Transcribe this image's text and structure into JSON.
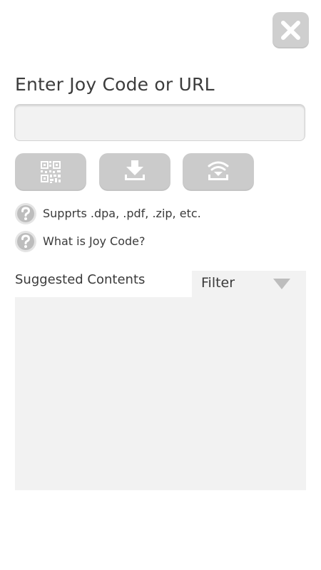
{
  "header": {
    "close_icon": "close-icon"
  },
  "entry": {
    "title": "Enter Joy Code or URL",
    "input_value": "",
    "input_placeholder": ""
  },
  "actions": [
    {
      "icon": "qr-code-icon"
    },
    {
      "icon": "download-icon"
    },
    {
      "icon": "wifi-download-icon"
    }
  ],
  "help": {
    "icon": "question-icon",
    "supports_text": "Supprts .dpa, .pdf, .zip, etc.",
    "joycode_text": "What is Joy Code?"
  },
  "suggested": {
    "label": "Suggested Contents",
    "filter_label": "Filter",
    "filter_icon": "triangle-down-icon",
    "items": []
  },
  "colors": {
    "button_gray": "#cbcbcb",
    "panel_gray": "#f2f2f2",
    "text": "#3a3a3a"
  }
}
